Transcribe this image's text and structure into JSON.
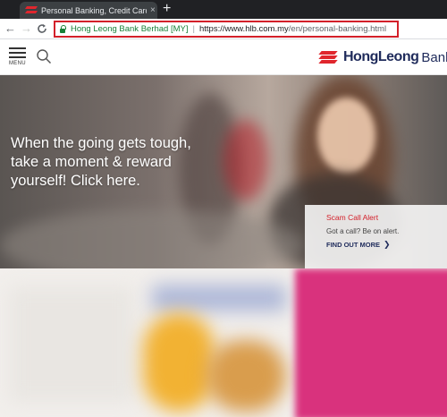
{
  "browser": {
    "tab_title": "Personal Banking, Credit Card",
    "tab_close": "×",
    "new_tab": "+",
    "back": "←",
    "forward": "→",
    "reload": "C",
    "site_identity": "Hong Leong Bank Berhad [MY]",
    "url_host": "https://www.hlb.com.my",
    "url_path": "/en/personal-banking.html"
  },
  "header": {
    "menu_label": "MENU",
    "logo_primary": "HongLeong",
    "logo_secondary": "Bank"
  },
  "hero": {
    "line1": "When the going gets tough,",
    "line2": "take a moment & reward",
    "line3": "yourself! Click here."
  },
  "alert": {
    "title": "Scam Call Alert",
    "body": "Got a call? Be on alert.",
    "link": "FIND OUT MORE",
    "link_chevron": "❯"
  },
  "colors": {
    "brand_red": "#e0262d",
    "brand_navy": "#1f2b5b",
    "highlight_red": "#d3202a",
    "secure_green": "#188038"
  }
}
